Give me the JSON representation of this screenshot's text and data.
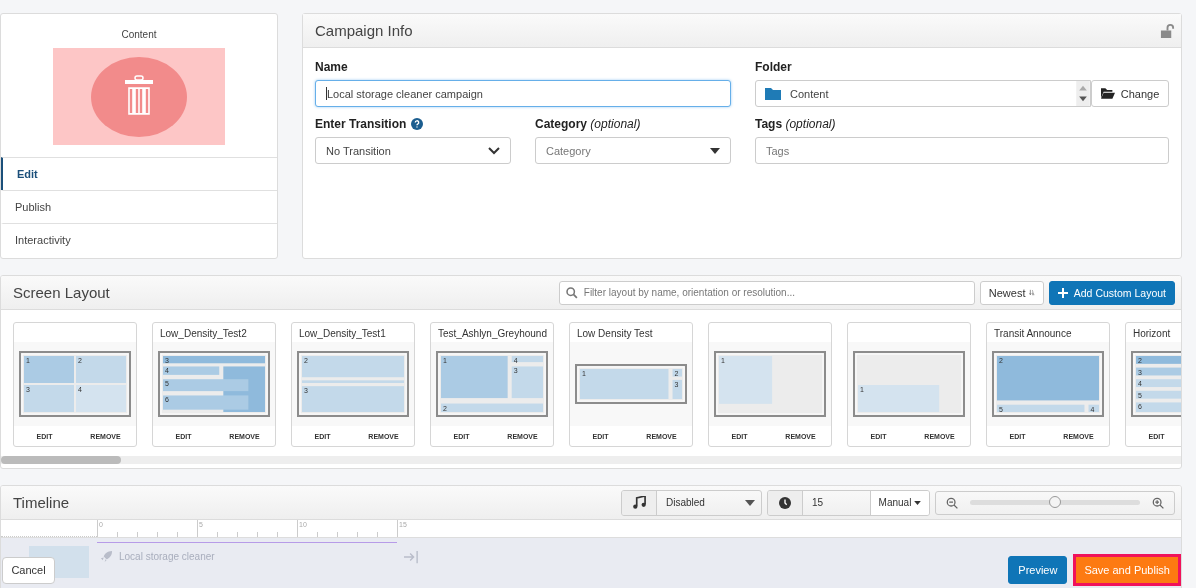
{
  "sidebar": {
    "content_label": "Content",
    "tabs": [
      {
        "label": "Edit",
        "selected": true
      },
      {
        "label": "Publish",
        "selected": false
      },
      {
        "label": "Interactivity",
        "selected": false
      }
    ]
  },
  "campaign_info": {
    "title": "Campaign Info",
    "name": {
      "label": "Name",
      "value": "Local storage cleaner campaign"
    },
    "folder": {
      "label": "Folder",
      "value": "Content",
      "button": "Change"
    },
    "enter_transition": {
      "label": "Enter Transition",
      "value": "No Transition"
    },
    "category": {
      "label": "Category",
      "note": "(optional)",
      "placeholder": "Category"
    },
    "tags": {
      "label": "Tags",
      "note": "(optional)",
      "placeholder": "Tags"
    }
  },
  "screen_layout": {
    "title": "Screen Layout",
    "search": {
      "placeholder": "Filter layout by name, orientation or resolution..."
    },
    "sort_button": "Newest",
    "add_button": "Add Custom Layout",
    "layouts": [
      {
        "kind": "quad",
        "zones": [
          "1",
          "2",
          "3",
          "4"
        ],
        "actions": [
          "EDIT",
          "REMOVE"
        ]
      },
      {
        "title": "Low_Density_Test2",
        "kind": "stack-side",
        "zones": [
          "3",
          "4",
          "5",
          "6"
        ],
        "actions": [
          "EDIT",
          "REMOVE"
        ]
      },
      {
        "title": "Low_Density_Test1",
        "kind": "bands",
        "zones": [
          "2",
          "3"
        ],
        "actions": [
          "EDIT",
          "REMOVE"
        ]
      },
      {
        "title": "Test_Ashlyn_Greyhound",
        "kind": "main-side",
        "zones": [
          "1",
          "4",
          "3",
          "2"
        ],
        "actions": [
          "EDIT",
          "REMOVE"
        ]
      },
      {
        "title": "Low Density Test",
        "kind": "wide-split",
        "zones": [
          "1",
          "2",
          "3"
        ],
        "actions": [
          "EDIT",
          "REMOVE"
        ]
      },
      {
        "kind": "left-block",
        "zones": [
          "1"
        ],
        "actions": [
          "EDIT",
          "REMOVE"
        ]
      },
      {
        "kind": "bottom-block",
        "zones": [
          "1"
        ],
        "actions": [
          "EDIT",
          "REMOVE"
        ]
      },
      {
        "title": "Transit Announce",
        "kind": "main-footer",
        "zones": [
          "2",
          "5",
          "4"
        ],
        "actions": [
          "EDIT",
          "REMOVE"
        ]
      },
      {
        "title": "Horizont",
        "kind": "rows",
        "zones": [
          "2",
          "3",
          "4",
          "5",
          "6"
        ],
        "actions": [
          "EDIT"
        ]
      }
    ]
  },
  "timeline": {
    "title": "Timeline",
    "audio": "Disabled",
    "duration": "15",
    "mode": "Manual",
    "zoom": {
      "level": 0.5
    },
    "ruler": [
      "0",
      "5",
      "10",
      "15"
    ],
    "item": "Local storage cleaner"
  },
  "footer": {
    "cancel": "Cancel",
    "preview": "Preview",
    "save": "Save and Publish"
  }
}
